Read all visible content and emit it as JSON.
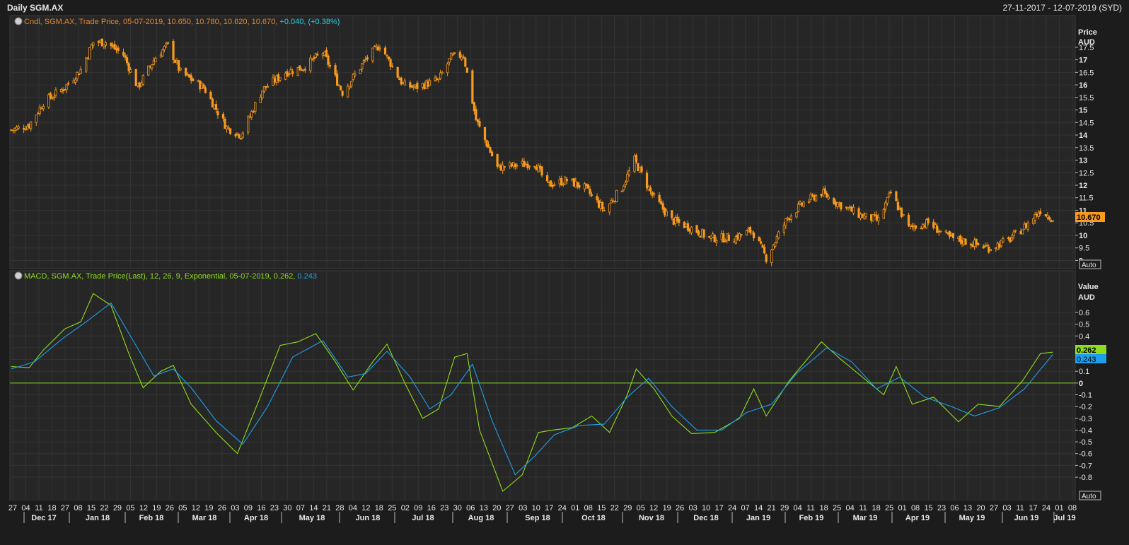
{
  "window": {
    "title": "Daily SGM.AX",
    "date_range": "27-11-2017 - 12-07-2019 (SYD)"
  },
  "price_panel": {
    "legend": {
      "prefix": "Cndl, SGM.AX, Trade Price, 05-07-2019, 10.650, 10.780, 10.620, 10.670, ",
      "change": "+0.040, (+0.38%)"
    },
    "axis_title_1": "Price",
    "axis_title_2": "AUD",
    "last_value": "10.670",
    "auto_label": "Auto",
    "colors": {
      "candle": "#f79a1e",
      "change": "#29d0e6",
      "label": "#e8862b"
    }
  },
  "macd_panel": {
    "legend": {
      "prefix": "MACD, SGM.AX, Trade Price(Last),  12, 26, 9, Exponential, 05-07-2019, 0.262, ",
      "signal_value": "0.243"
    },
    "axis_title_1": "Value",
    "axis_title_2": "AUD",
    "macd_value": "0.262",
    "signal_value": "0.243",
    "auto_label": "Auto",
    "colors": {
      "macd": "#8fdc1c",
      "signal": "#1e9fea",
      "zero": "#7fd21e"
    }
  },
  "x_axis": {
    "day_ticks": [
      "27",
      "04",
      "11",
      "18",
      "27",
      "08",
      "15",
      "22",
      "29",
      "05",
      "12",
      "19",
      "26",
      "05",
      "12",
      "19",
      "26",
      "03",
      "09",
      "16",
      "23",
      "30",
      "07",
      "14",
      "21",
      "28",
      "04",
      "12",
      "18",
      "25",
      "02",
      "09",
      "16",
      "23",
      "30",
      "06",
      "13",
      "20",
      "27",
      "03",
      "10",
      "17",
      "24",
      "01",
      "08",
      "15",
      "22",
      "29",
      "05",
      "12",
      "19",
      "26",
      "03",
      "10",
      "17",
      "24",
      "07",
      "14",
      "21",
      "29",
      "04",
      "11",
      "18",
      "25",
      "04",
      "11",
      "18",
      "25",
      "01",
      "08",
      "15",
      "23",
      "06",
      "13",
      "20",
      "27",
      "03",
      "11",
      "17",
      "24",
      "01",
      "08"
    ],
    "month_labels": [
      "Dec 17",
      "Jan 18",
      "Feb 18",
      "Mar 18",
      "Apr 18",
      "May 18",
      "Jun 18",
      "Jul 18",
      "Aug 18",
      "Sep 18",
      "Oct 18",
      "Nov 18",
      "Dec 18",
      "Jan 19",
      "Feb 19",
      "Mar 19",
      "Apr 19",
      "May 19",
      "Jun 19",
      "Jul 19"
    ]
  },
  "chart_data": [
    {
      "type": "candlestick",
      "title": "Cndl, SGM.AX, Trade Price",
      "ylabel": "Price AUD",
      "ylim": [
        8.9,
        18.2
      ],
      "yticks": [
        9,
        9.5,
        10,
        10.5,
        11,
        11.5,
        12,
        12.5,
        13,
        13.5,
        14,
        14.5,
        15,
        15.5,
        16,
        16.5,
        17,
        17.5
      ],
      "x_start": "2017-11-27",
      "x_end": "2019-07-12",
      "last_bar": {
        "date": "2019-07-05",
        "open": 10.65,
        "high": 10.78,
        "low": 10.62,
        "close": 10.67
      },
      "close_path": [
        [
          "2017-11-27",
          14.2
        ],
        [
          "2017-12-07",
          14.4
        ],
        [
          "2017-12-15",
          15.3
        ],
        [
          "2017-12-27",
          15.9
        ],
        [
          "2018-01-05",
          16.6
        ],
        [
          "2018-01-12",
          17.7
        ],
        [
          "2018-01-19",
          17.7
        ],
        [
          "2018-01-29",
          17.2
        ],
        [
          "2018-02-06",
          15.9
        ],
        [
          "2018-02-16",
          17.1
        ],
        [
          "2018-02-23",
          17.6
        ],
        [
          "2018-03-02",
          16.5
        ],
        [
          "2018-03-15",
          15.9
        ],
        [
          "2018-03-28",
          14.3
        ],
        [
          "2018-04-05",
          14.0
        ],
        [
          "2018-04-17",
          15.8
        ],
        [
          "2018-04-30",
          16.5
        ],
        [
          "2018-05-10",
          16.7
        ],
        [
          "2018-05-21",
          17.3
        ],
        [
          "2018-06-01",
          15.7
        ],
        [
          "2018-06-14",
          17.0
        ],
        [
          "2018-06-22",
          17.6
        ],
        [
          "2018-07-05",
          16.0
        ],
        [
          "2018-07-12",
          15.9
        ],
        [
          "2018-07-25",
          16.2
        ],
        [
          "2018-08-01",
          17.1
        ],
        [
          "2018-08-08",
          17.2
        ],
        [
          "2018-08-15",
          14.6
        ],
        [
          "2018-08-27",
          12.7
        ],
        [
          "2018-09-07",
          12.8
        ],
        [
          "2018-09-17",
          12.9
        ],
        [
          "2018-09-24",
          12.0
        ],
        [
          "2018-10-05",
          12.2
        ],
        [
          "2018-10-15",
          11.9
        ],
        [
          "2018-10-26",
          11.0
        ],
        [
          "2018-11-05",
          11.9
        ],
        [
          "2018-11-12",
          13.0
        ],
        [
          "2018-11-22",
          11.6
        ],
        [
          "2018-12-03",
          10.6
        ],
        [
          "2018-12-14",
          10.3
        ],
        [
          "2018-12-24",
          9.9
        ],
        [
          "2019-01-07",
          9.9
        ],
        [
          "2019-01-17",
          10.2
        ],
        [
          "2019-01-25",
          9.1
        ],
        [
          "2019-02-06",
          10.7
        ],
        [
          "2019-02-15",
          11.3
        ],
        [
          "2019-02-25",
          11.7
        ],
        [
          "2019-03-08",
          11.2
        ],
        [
          "2019-03-19",
          10.8
        ],
        [
          "2019-03-29",
          10.6
        ],
        [
          "2019-04-05",
          11.7
        ],
        [
          "2019-04-15",
          10.3
        ],
        [
          "2019-04-26",
          10.5
        ],
        [
          "2019-05-08",
          9.9
        ],
        [
          "2019-05-20",
          9.7
        ],
        [
          "2019-05-30",
          9.5
        ],
        [
          "2019-06-10",
          9.8
        ],
        [
          "2019-06-20",
          10.4
        ],
        [
          "2019-06-28",
          11.0
        ],
        [
          "2019-07-05",
          10.67
        ]
      ]
    },
    {
      "type": "line",
      "title": "MACD, SGM.AX, Trade Price(Last), 12, 26, 9, Exponential",
      "ylabel": "Value AUD",
      "ylim": [
        -0.95,
        0.78
      ],
      "yticks": [
        -0.8,
        -0.7,
        -0.6,
        -0.5,
        -0.4,
        -0.3,
        -0.2,
        -0.1,
        0,
        0.1,
        0.2,
        0.3,
        0.4,
        0.5,
        0.6
      ],
      "series": [
        {
          "name": "MACD",
          "values": [
            [
              "2017-11-27",
              0.14
            ],
            [
              "2017-12-07",
              0.13
            ],
            [
              "2017-12-15",
              0.28
            ],
            [
              "2017-12-27",
              0.46
            ],
            [
              "2018-01-05",
              0.52
            ],
            [
              "2018-01-12",
              0.76
            ],
            [
              "2018-01-22",
              0.66
            ],
            [
              "2018-02-01",
              0.25
            ],
            [
              "2018-02-09",
              -0.04
            ],
            [
              "2018-02-19",
              0.1
            ],
            [
              "2018-02-26",
              0.15
            ],
            [
              "2018-03-08",
              -0.18
            ],
            [
              "2018-03-22",
              -0.42
            ],
            [
              "2018-04-03",
              -0.6
            ],
            [
              "2018-04-15",
              -0.15
            ],
            [
              "2018-04-27",
              0.32
            ],
            [
              "2018-05-07",
              0.35
            ],
            [
              "2018-05-17",
              0.42
            ],
            [
              "2018-05-28",
              0.18
            ],
            [
              "2018-06-07",
              -0.06
            ],
            [
              "2018-06-18",
              0.18
            ],
            [
              "2018-06-26",
              0.33
            ],
            [
              "2018-07-06",
              0.0
            ],
            [
              "2018-07-16",
              -0.3
            ],
            [
              "2018-07-25",
              -0.22
            ],
            [
              "2018-08-03",
              0.22
            ],
            [
              "2018-08-10",
              0.25
            ],
            [
              "2018-08-17",
              -0.4
            ],
            [
              "2018-08-30",
              -0.92
            ],
            [
              "2018-09-10",
              -0.78
            ],
            [
              "2018-09-19",
              -0.42
            ],
            [
              "2018-09-27",
              -0.4
            ],
            [
              "2018-10-08",
              -0.38
            ],
            [
              "2018-10-19",
              -0.28
            ],
            [
              "2018-10-29",
              -0.42
            ],
            [
              "2018-11-08",
              -0.1
            ],
            [
              "2018-11-13",
              0.12
            ],
            [
              "2018-11-23",
              -0.05
            ],
            [
              "2018-12-03",
              -0.28
            ],
            [
              "2018-12-14",
              -0.43
            ],
            [
              "2018-12-27",
              -0.42
            ],
            [
              "2019-01-10",
              -0.3
            ],
            [
              "2019-01-18",
              -0.05
            ],
            [
              "2019-01-25",
              -0.28
            ],
            [
              "2019-02-07",
              0.02
            ],
            [
              "2019-02-18",
              0.22
            ],
            [
              "2019-02-25",
              0.35
            ],
            [
              "2019-03-08",
              0.2
            ],
            [
              "2019-03-20",
              0.05
            ],
            [
              "2019-04-01",
              -0.1
            ],
            [
              "2019-04-08",
              0.14
            ],
            [
              "2019-04-17",
              -0.18
            ],
            [
              "2019-04-29",
              -0.12
            ],
            [
              "2019-05-13",
              -0.33
            ],
            [
              "2019-05-24",
              -0.18
            ],
            [
              "2019-06-05",
              -0.2
            ],
            [
              "2019-06-18",
              0.02
            ],
            [
              "2019-06-28",
              0.25
            ],
            [
              "2019-07-05",
              0.262
            ]
          ]
        },
        {
          "name": "Signal",
          "values": [
            [
              "2017-11-27",
              0.12
            ],
            [
              "2017-12-10",
              0.18
            ],
            [
              "2017-12-26",
              0.38
            ],
            [
              "2018-01-08",
              0.52
            ],
            [
              "2018-01-22",
              0.68
            ],
            [
              "2018-02-05",
              0.32
            ],
            [
              "2018-02-15",
              0.06
            ],
            [
              "2018-02-26",
              0.12
            ],
            [
              "2018-03-08",
              -0.04
            ],
            [
              "2018-03-22",
              -0.32
            ],
            [
              "2018-04-06",
              -0.52
            ],
            [
              "2018-04-20",
              -0.2
            ],
            [
              "2018-05-04",
              0.22
            ],
            [
              "2018-05-21",
              0.36
            ],
            [
              "2018-06-04",
              0.05
            ],
            [
              "2018-06-14",
              0.08
            ],
            [
              "2018-06-26",
              0.27
            ],
            [
              "2018-07-09",
              0.05
            ],
            [
              "2018-07-20",
              -0.22
            ],
            [
              "2018-08-01",
              -0.1
            ],
            [
              "2018-08-13",
              0.16
            ],
            [
              "2018-08-24",
              -0.32
            ],
            [
              "2018-09-06",
              -0.78
            ],
            [
              "2018-09-17",
              -0.62
            ],
            [
              "2018-09-28",
              -0.44
            ],
            [
              "2018-10-12",
              -0.36
            ],
            [
              "2018-10-26",
              -0.35
            ],
            [
              "2018-11-08",
              -0.12
            ],
            [
              "2018-11-20",
              0.04
            ],
            [
              "2018-12-03",
              -0.2
            ],
            [
              "2018-12-17",
              -0.4
            ],
            [
              "2018-12-31",
              -0.4
            ],
            [
              "2019-01-14",
              -0.25
            ],
            [
              "2019-01-28",
              -0.18
            ],
            [
              "2019-02-11",
              0.08
            ],
            [
              "2019-02-28",
              0.3
            ],
            [
              "2019-03-14",
              0.18
            ],
            [
              "2019-03-28",
              -0.05
            ],
            [
              "2019-04-10",
              0.05
            ],
            [
              "2019-04-24",
              -0.12
            ],
            [
              "2019-05-09",
              -0.2
            ],
            [
              "2019-05-22",
              -0.28
            ],
            [
              "2019-06-05",
              -0.21
            ],
            [
              "2019-06-19",
              -0.05
            ],
            [
              "2019-07-05",
              0.243
            ]
          ]
        }
      ]
    }
  ]
}
